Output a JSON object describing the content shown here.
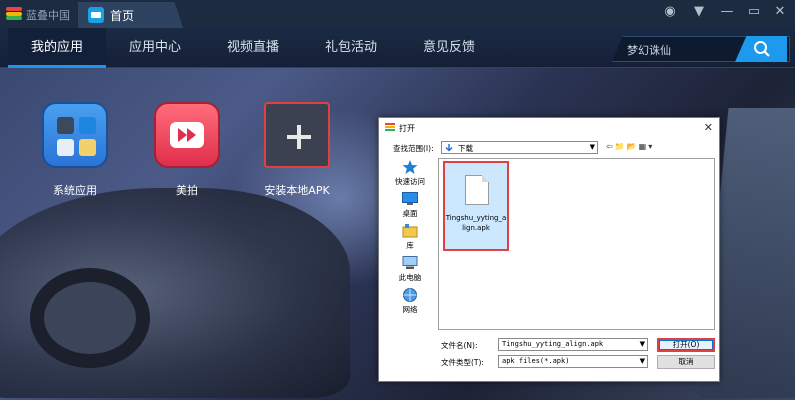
{
  "app": {
    "name": "蓝叠中国",
    "tab_home": "首页"
  },
  "nav": {
    "items": [
      {
        "label": "我的应用",
        "active": true
      },
      {
        "label": "应用中心",
        "active": false
      },
      {
        "label": "视频直播",
        "active": false
      },
      {
        "label": "礼包活动",
        "active": false
      },
      {
        "label": "意见反馈",
        "active": false
      }
    ],
    "search_text": "梦幻诛仙"
  },
  "apps": [
    {
      "label": "系统应用"
    },
    {
      "label": "美拍"
    },
    {
      "label": "安装本地APK"
    }
  ],
  "dialog": {
    "title": "打开",
    "look_in_label": "查找范围(I):",
    "look_in_value": "下载",
    "places": [
      "快速访问",
      "桌面",
      "库",
      "此电脑",
      "网络"
    ],
    "file_name_display": "Tingshu_yyting_align.apk",
    "file_name_label": "文件名(N):",
    "file_name_value": "Tingshu_yyting_align.apk",
    "file_type_label": "文件类型(T):",
    "file_type_value": "apk files(*.apk)",
    "open_button": "打开(O)",
    "cancel_button": "取消"
  },
  "colors": {
    "accent": "#1e96f0",
    "highlight": "#e04040"
  }
}
